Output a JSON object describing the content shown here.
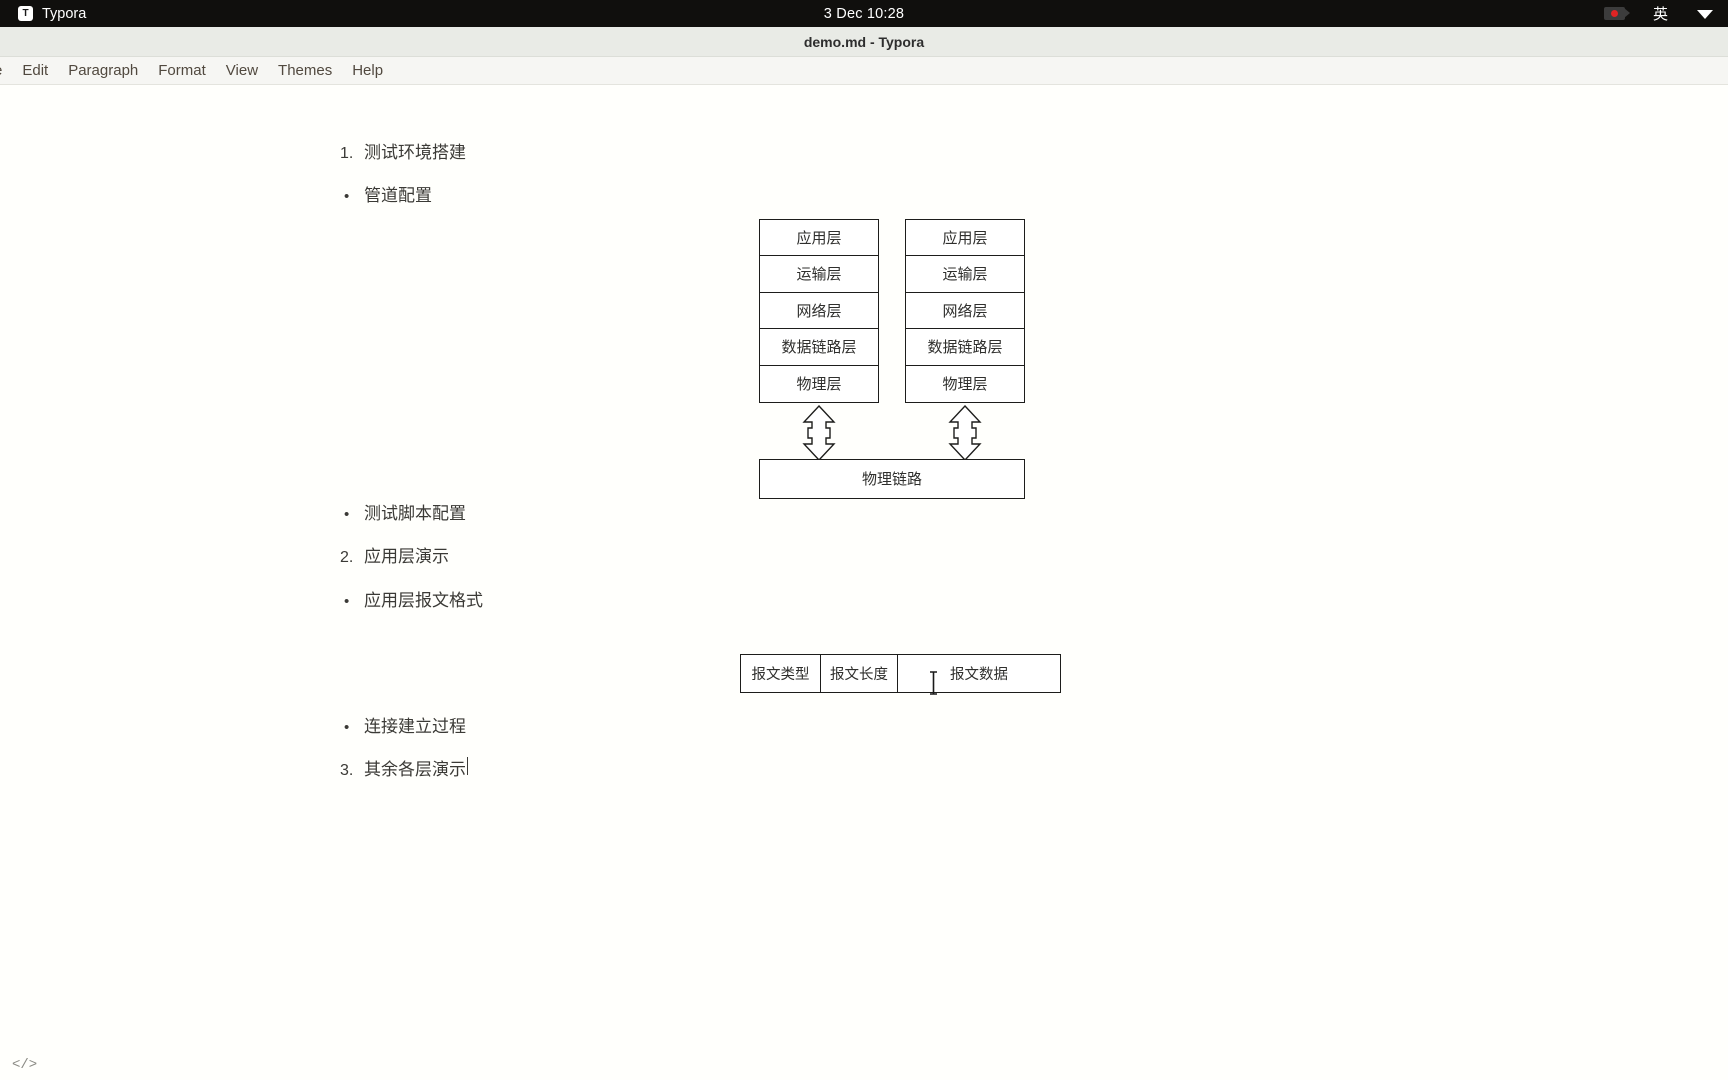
{
  "system_bar": {
    "app_name": "Typora",
    "app_badge_letter": "T",
    "datetime": "3 Dec  10:28",
    "tray": {
      "recording_icon": "screen-recording-icon",
      "input_method": "英",
      "network_icon": "wifi-icon"
    }
  },
  "window": {
    "title": "demo.md - Typora"
  },
  "menu": {
    "items": [
      {
        "label": "e"
      },
      {
        "label": "Edit"
      },
      {
        "label": "Paragraph"
      },
      {
        "label": "Format"
      },
      {
        "label": "View"
      },
      {
        "label": "Themes"
      },
      {
        "label": "Help"
      }
    ]
  },
  "document": {
    "blocks": [
      {
        "marker": "1.",
        "type": "ordered",
        "text": "测试环境搭建"
      },
      {
        "marker": "•",
        "type": "bullet",
        "text": "管道配置"
      },
      {
        "marker": "•",
        "type": "bullet",
        "text": "测试脚本配置"
      },
      {
        "marker": "2.",
        "type": "ordered",
        "text": "应用层演示"
      },
      {
        "marker": "•",
        "type": "bullet",
        "text": "应用层报文格式"
      },
      {
        "marker": "•",
        "type": "bullet",
        "text": "连接建立过程"
      },
      {
        "marker": "3.",
        "type": "ordered",
        "text": "其余各层演示"
      }
    ]
  },
  "osi_diagram": {
    "left_stack": [
      "应用层",
      "运输层",
      "网络层",
      "数据链路层",
      "物理层"
    ],
    "right_stack": [
      "应用层",
      "运输层",
      "网络层",
      "数据链路层",
      "物理层"
    ],
    "link_label": "物理链路",
    "arrow_type": "double-headed-hollow-arrow"
  },
  "packet_format": {
    "cells": [
      "报文类型",
      "报文长度",
      "报文数据"
    ]
  },
  "status_bar": {
    "source_toggle": "</>"
  },
  "colors": {
    "system_bar_bg": "#100f0d",
    "title_bar_bg": "#e9ebe6",
    "menu_bar_bg": "#f6f6f3",
    "editor_bg": "#fffffc",
    "text": "#3b3a36",
    "diagram_stroke": "#1d1d1b",
    "rec_dot": "#e02424"
  }
}
